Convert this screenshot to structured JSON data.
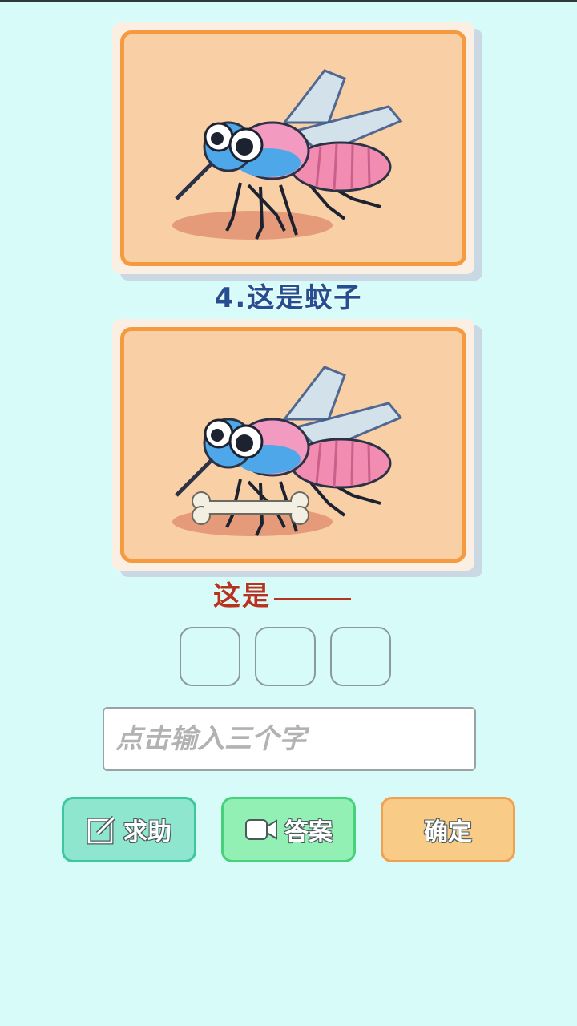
{
  "reference_card": {
    "image": "mosquito-pixel-art",
    "caption": "4.这是蚊子"
  },
  "puzzle_card": {
    "image": "mosquito-with-bone-pixel-art"
  },
  "question": {
    "prefix": "这是"
  },
  "answer_slots": [
    "",
    "",
    ""
  ],
  "input": {
    "placeholder": "点击输入三个字",
    "value": ""
  },
  "buttons": {
    "help_label": "求助",
    "help_icon": "edit-icon",
    "answer_label": "答案",
    "answer_icon": "video-icon",
    "confirm_label": "确定"
  },
  "colors": {
    "background": "#d6fbf8",
    "caption": "#254f90",
    "question": "#b5341f",
    "help": "#8ee6cf",
    "answer": "#93f0b5",
    "confirm": "#f8cb86"
  }
}
